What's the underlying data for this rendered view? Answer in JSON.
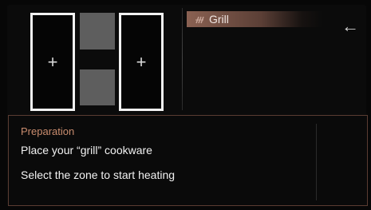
{
  "zones": [
    {
      "label": "+"
    },
    {
      "label": "+"
    }
  ],
  "program": {
    "label": "Grill",
    "icon": "grill-icon"
  },
  "navigation": {
    "back_icon": "back-arrow-icon",
    "back_glyph": "←"
  },
  "info": {
    "heading": "Preparation",
    "lines": [
      "Place your “grill” cookware",
      "Select the zone to start heating"
    ]
  },
  "colors": {
    "accent": "#c98c6e",
    "panel_border": "#5a3c32",
    "zone_border": "#f2f2f2",
    "bridge_fill": "#5e5e5e"
  }
}
